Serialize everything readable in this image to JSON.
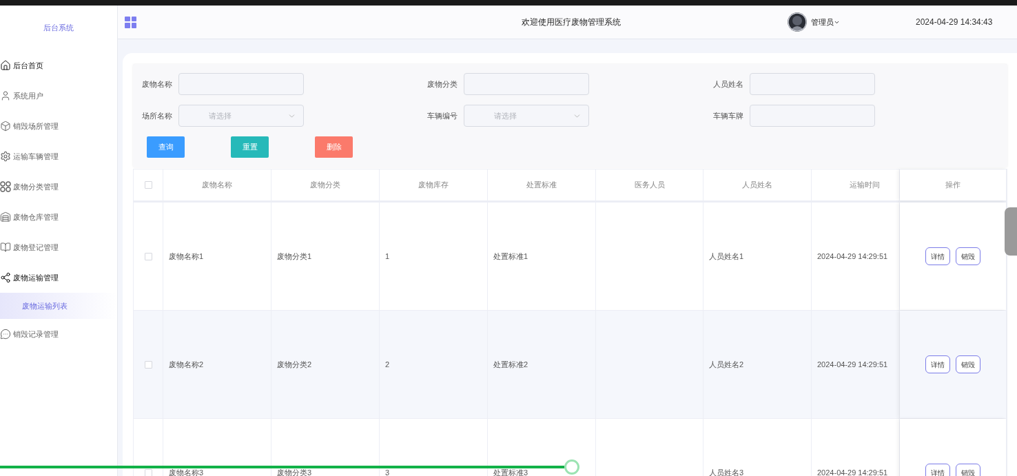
{
  "sidebar": {
    "title": "后台系统",
    "items": [
      {
        "label": "后台首页",
        "kind": "home",
        "highlighted": true
      },
      {
        "label": "系统用户",
        "kind": "user",
        "highlighted": false
      },
      {
        "label": "销毁场所管理",
        "kind": "box",
        "highlighted": false
      },
      {
        "label": "运输车辆管理",
        "kind": "gear",
        "highlighted": false
      },
      {
        "label": "废物分类管理",
        "kind": "circles",
        "highlighted": false
      },
      {
        "label": "废物仓库管理",
        "kind": "tray",
        "highlighted": false
      },
      {
        "label": "废物登记管理",
        "kind": "book",
        "highlighted": false
      },
      {
        "label": "废物运输管理",
        "kind": "nodes",
        "highlighted": true,
        "expanded": true,
        "children": [
          {
            "label": "废物运输列表",
            "selected": true
          }
        ]
      },
      {
        "label": "销毁记录管理",
        "kind": "chat",
        "highlighted": false
      }
    ]
  },
  "header": {
    "title": "欢迎使用医疗废物管理系统",
    "user": "管理员",
    "datetime": "2024-04-29 14:34:43"
  },
  "filters": [
    {
      "label": "废物名称",
      "kind": "input"
    },
    {
      "label": "废物分类",
      "kind": "input"
    },
    {
      "label": "人员姓名",
      "kind": "input"
    },
    {
      "label": "场所名称",
      "kind": "select",
      "placeholder": "请选择"
    },
    {
      "label": "车辆编号",
      "kind": "select",
      "placeholder": "请选择"
    },
    {
      "label": "车辆车牌",
      "kind": "input"
    }
  ],
  "buttons": [
    {
      "label": "查询",
      "kind": "primary"
    },
    {
      "label": "重置",
      "kind": "reset"
    },
    {
      "label": "删除",
      "kind": "danger"
    }
  ],
  "table": {
    "all_checked": false,
    "columns": [
      "废物名称",
      "废物分类",
      "废物库存",
      "处置标准",
      "医务人员",
      "人员姓名",
      "运输时间",
      "操作"
    ],
    "rows": [
      {
        "checked": false,
        "cells": [
          "废物名称1",
          "废物分类1",
          "1",
          "处置标准1",
          null,
          "人员姓名1",
          "2024-04-29 14:29:51"
        ],
        "actions": [
          "详情",
          "销毁"
        ]
      },
      {
        "checked": false,
        "cells": [
          "废物名称2",
          "废物分类2",
          "2",
          "处置标准2",
          null,
          "人员姓名2",
          "2024-04-29 14:29:51"
        ],
        "actions": [
          "详情",
          "销毁"
        ]
      },
      {
        "checked": false,
        "cells": [
          "废物名称3",
          "废物分类3",
          "3",
          "处置标准3",
          null,
          "人员姓名3",
          "2024-04-29 14:29:51"
        ],
        "actions": [
          "详情",
          "销毁"
        ]
      }
    ]
  },
  "player": {
    "level": 0.562
  }
}
